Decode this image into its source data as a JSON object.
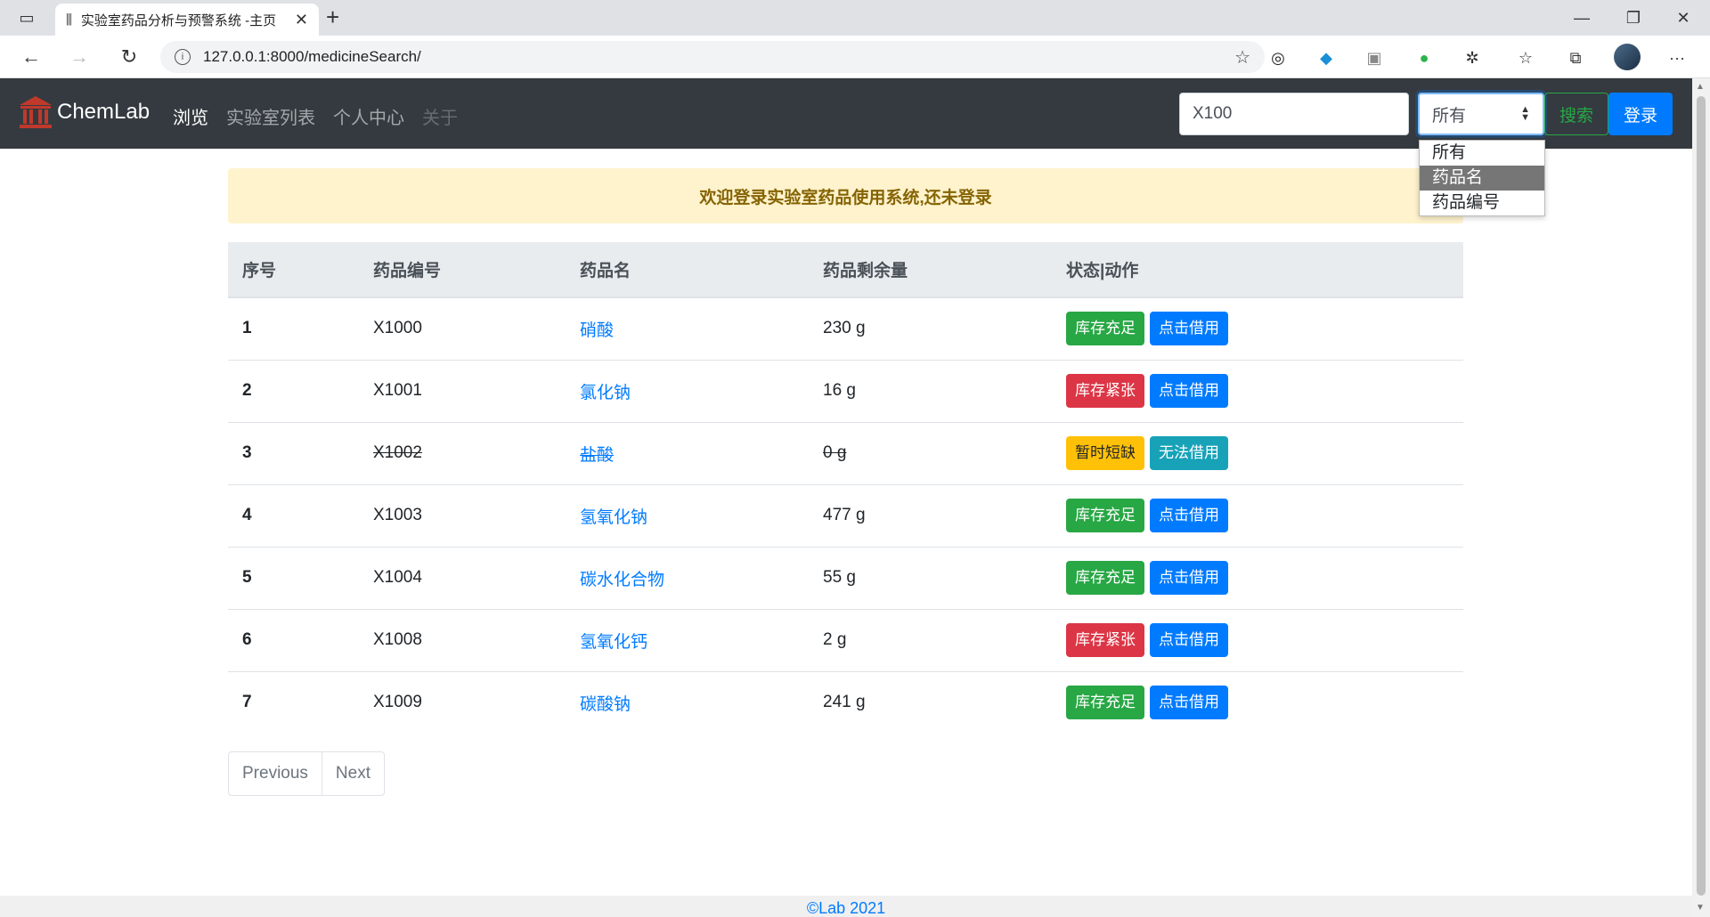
{
  "browser": {
    "tab_title": "实验室药品分析与预警系统 -主页",
    "url": "127.0.0.1:8000/medicineSearch/"
  },
  "site": {
    "brand": "ChemLab",
    "nav": {
      "browse": "浏览",
      "lab_list": "实验室列表",
      "profile": "个人中心",
      "about": "关于"
    },
    "search": {
      "value": "X100",
      "select_value": "所有",
      "options": [
        "所有",
        "药品名",
        "药品编号"
      ],
      "search_label": "搜索",
      "login_label": "登录"
    },
    "alert": "欢迎登录实验室药品使用系统,还未登录",
    "table": {
      "headers": [
        "序号",
        "药品编号",
        "药品名",
        "药品剩余量",
        "状态|动作"
      ],
      "rows": [
        {
          "idx": "1",
          "code": "X1000",
          "name": "硝酸",
          "amount": "230 g",
          "status": "库存充足",
          "action": "点击借用"
        },
        {
          "idx": "2",
          "code": "X1001",
          "name": "氯化钠",
          "amount": "16 g",
          "status": "库存紧张",
          "action": "点击借用"
        },
        {
          "idx": "3",
          "code": "X1002",
          "name": "盐酸",
          "amount": "0 g",
          "status": "暂时短缺",
          "action": "无法借用"
        },
        {
          "idx": "4",
          "code": "X1003",
          "name": "氢氧化钠",
          "amount": "477 g",
          "status": "库存充足",
          "action": "点击借用"
        },
        {
          "idx": "5",
          "code": "X1004",
          "name": "碳水化合物",
          "amount": "55 g",
          "status": "库存充足",
          "action": "点击借用"
        },
        {
          "idx": "6",
          "code": "X1008",
          "name": "氢氧化钙",
          "amount": "2 g",
          "status": "库存紧张",
          "action": "点击借用"
        },
        {
          "idx": "7",
          "code": "X1009",
          "name": "碳酸钠",
          "amount": "241 g",
          "status": "库存充足",
          "action": "点击借用"
        }
      ]
    },
    "pager": {
      "prev": "Previous",
      "next": "Next"
    },
    "footer": "©Lab 2021"
  }
}
